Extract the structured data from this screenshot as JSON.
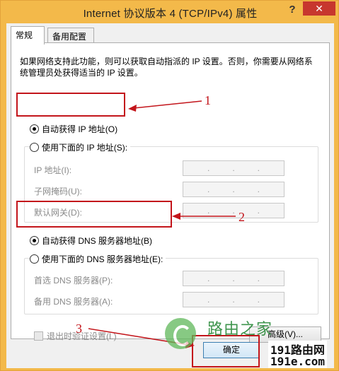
{
  "window": {
    "title": "Internet 协议版本 4 (TCP/IPv4) 属性",
    "help": "?",
    "close": "✕"
  },
  "tabs": [
    {
      "label": "常规",
      "active": true
    },
    {
      "label": "备用配置",
      "active": false
    }
  ],
  "description": "如果网络支持此功能，则可以获取自动指派的 IP 设置。否则，你需要从网络系统管理员处获得适当的 IP 设置。",
  "ip_section": {
    "auto_label": "自动获得 IP 地址(O)",
    "auto_checked": true,
    "manual_label": "使用下面的 IP 地址(S):",
    "manual_checked": false,
    "fields": [
      {
        "label": "IP 地址(I):",
        "value": ". . ."
      },
      {
        "label": "子网掩码(U):",
        "value": ". . ."
      },
      {
        "label": "默认网关(D):",
        "value": ". . ."
      }
    ]
  },
  "dns_section": {
    "auto_label": "自动获得 DNS 服务器地址(B)",
    "auto_checked": true,
    "manual_label": "使用下面的 DNS 服务器地址(E):",
    "manual_checked": false,
    "fields": [
      {
        "label": "首选 DNS 服务器(P):",
        "value": ". . ."
      },
      {
        "label": "备用 DNS 服务器(A):",
        "value": ". . ."
      }
    ]
  },
  "validate_label": "退出时验证设置(L)",
  "advanced_label": "高级(V)...",
  "ok_label": "确定",
  "annotations": {
    "one": "1",
    "two": "2",
    "three": "3",
    "color": "#c3151b"
  },
  "watermark": {
    "text": "路由之家",
    "line1": "191路由网",
    "line2": "191e.com"
  }
}
